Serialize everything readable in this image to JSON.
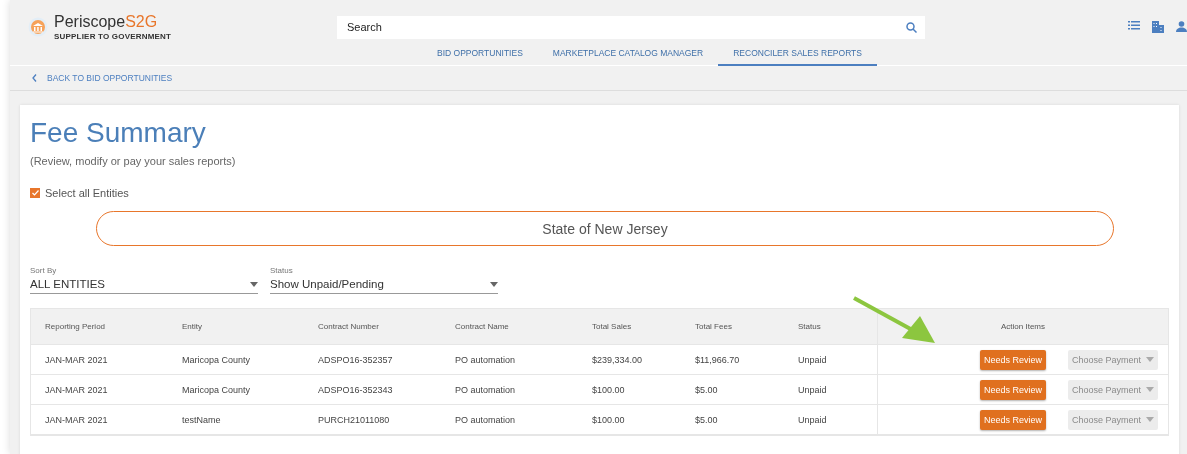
{
  "header": {
    "logo": {
      "name": "Periscope",
      "accent": "S2G",
      "tagline": "SUPPLIER TO GOVERNMENT"
    },
    "search": {
      "placeholder": "Search"
    }
  },
  "nav_tabs": [
    {
      "label": "BID OPPORTUNITIES",
      "selected": false
    },
    {
      "label": "MARKETPLACE CATALOG MANAGER",
      "selected": false
    },
    {
      "label": "RECONCILER SALES REPORTS",
      "selected": true
    }
  ],
  "back_link": "BACK TO BID OPPORTUNITIES",
  "title": "Fee Summary",
  "subtitle": "(Review, modify or pay your sales reports)",
  "select_all": {
    "label": "Select all Entities",
    "checked": true
  },
  "entity_pill": "State of New Jersey",
  "filters": [
    {
      "label": "Sort By",
      "value": "ALL ENTITIES"
    },
    {
      "label": "Status",
      "value": "Show Unpaid/Pending"
    }
  ],
  "table": {
    "columns": [
      "Reporting Period",
      "Entity",
      "Contract Number",
      "Contract Name",
      "Total Sales",
      "Total Fees",
      "Status",
      "Action Items"
    ],
    "rows": [
      {
        "cells": [
          "JAN-MAR 2021",
          "Maricopa County",
          "ADSPO16-352357",
          "PO automation",
          "$239,334.00",
          "$11,966.70",
          "Unpaid"
        ],
        "action": "Needs Review",
        "payment": {
          "placeholder": "Choose Payment",
          "disabled": true
        }
      },
      {
        "cells": [
          "JAN-MAR 2021",
          "Maricopa County",
          "ADSPO16-352343",
          "PO automation",
          "$100.00",
          "$5.00",
          "Unpaid"
        ],
        "action": "Needs Review",
        "payment": {
          "placeholder": "Choose Payment",
          "disabled": true
        }
      },
      {
        "cells": [
          "JAN-MAR 2021",
          "testName",
          "PURCH21011080",
          "PO automation",
          "$100.00",
          "$5.00",
          "Unpaid"
        ],
        "action": "Needs Review",
        "payment": {
          "placeholder": "Choose Payment",
          "disabled": true
        }
      }
    ]
  }
}
